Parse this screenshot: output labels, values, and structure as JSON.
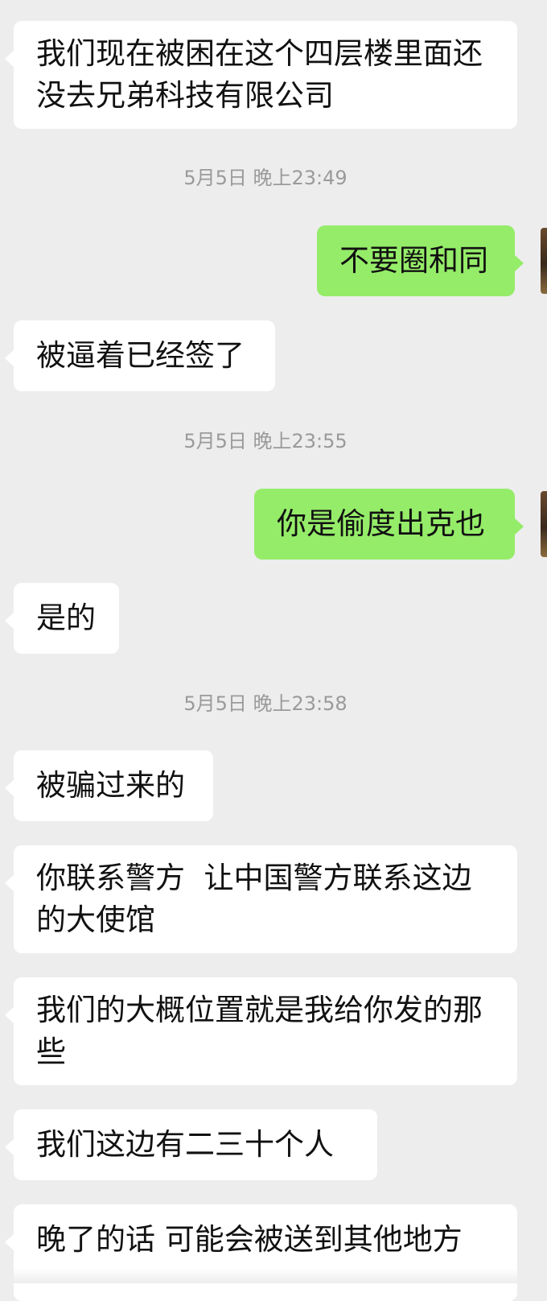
{
  "messages": [
    {
      "kind": "in",
      "text": "我们现在被困在这个四层楼里面还没去兄弟科技有限公司"
    },
    {
      "kind": "time",
      "text": "5月5日 晚上23:49"
    },
    {
      "kind": "out",
      "text": "不要圈和同"
    },
    {
      "kind": "in",
      "text": "被逼着已经签了"
    },
    {
      "kind": "time",
      "text": "5月5日 晚上23:55"
    },
    {
      "kind": "out",
      "text": "你是偷度出克也"
    },
    {
      "kind": "in",
      "text": "是的"
    },
    {
      "kind": "time",
      "text": "5月5日 晚上23:58"
    },
    {
      "kind": "in",
      "text": "被骗过来的"
    },
    {
      "kind": "in",
      "text": "你联系警方  让中国警方联系这边的大使馆"
    },
    {
      "kind": "in",
      "text": "我们的大概位置就是我给你发的那些"
    },
    {
      "kind": "in",
      "text": "我们这边有二三十个人"
    },
    {
      "kind": "in",
      "text": "晚了的话 可能会被送到其他地方"
    }
  ],
  "colors": {
    "background": "#ededed",
    "incoming_bubble": "#ffffff",
    "outgoing_bubble": "#95ec69",
    "timestamp_text": "#9a9a9a"
  },
  "icons": [
    "user-avatar"
  ]
}
